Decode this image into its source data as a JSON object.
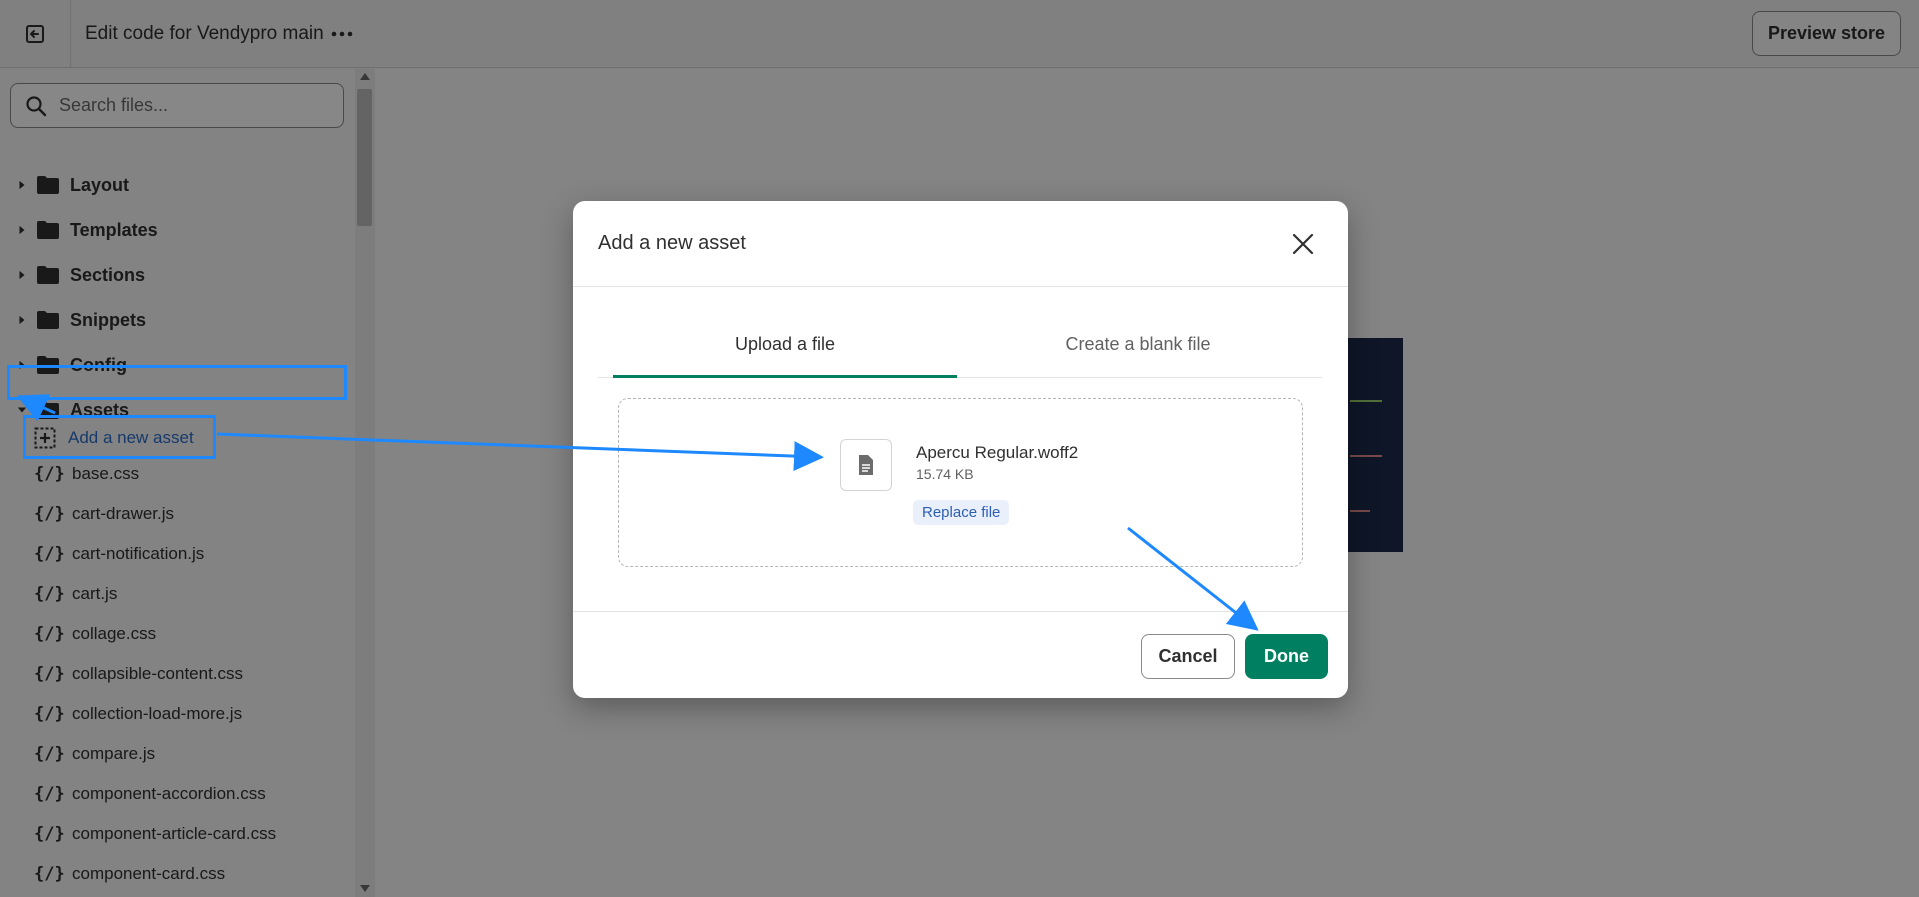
{
  "header": {
    "title": "Edit code for Vendypro main",
    "preview_label": "Preview store"
  },
  "sidebar": {
    "search_placeholder": "Search files...",
    "folders": [
      {
        "label": "Layout",
        "expanded": false
      },
      {
        "label": "Templates",
        "expanded": false
      },
      {
        "label": "Sections",
        "expanded": false
      },
      {
        "label": "Snippets",
        "expanded": false
      },
      {
        "label": "Config",
        "expanded": false
      },
      {
        "label": "Assets",
        "expanded": true
      }
    ],
    "add_asset_label": "Add a new asset",
    "files": [
      "base.css",
      "cart-drawer.js",
      "cart-notification.js",
      "cart.js",
      "collage.css",
      "collapsible-content.css",
      "collection-load-more.js",
      "compare.js",
      "component-accordion.css",
      "component-article-card.css",
      "component-card.css"
    ],
    "file_icon_glyph": "{/}"
  },
  "modal": {
    "title": "Add a new asset",
    "tabs": [
      {
        "label": "Upload a file",
        "active": true
      },
      {
        "label": "Create a blank file",
        "active": false
      }
    ],
    "file": {
      "name": "Apercu Regular.woff2",
      "size": "15.74 KB",
      "replace_label": "Replace file"
    },
    "cancel_label": "Cancel",
    "done_label": "Done"
  },
  "colors": {
    "primary": "#008060",
    "link": "#2c6ecb",
    "annotation": "#1e88ff"
  }
}
